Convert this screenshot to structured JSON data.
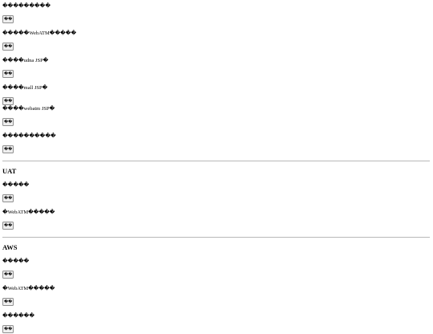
{
  "sections": [
    {
      "heading": "",
      "items": [
        {
          "label": "���������",
          "button": "��"
        },
        {
          "label": "�����WebATM�����",
          "button": "��"
        },
        {
          "label": "����udna JSP�",
          "button": "��"
        },
        {
          "label": "����mall JSP�",
          "button": "��"
        },
        {
          "label": "����webatm JSP�",
          "button": "��"
        },
        {
          "label": "����������",
          "button": "��"
        }
      ]
    },
    {
      "heading": "UAT",
      "items": [
        {
          "label": "�����",
          "button": "��"
        },
        {
          "label": "�WebATM�����",
          "button": "��"
        }
      ]
    },
    {
      "heading": "AWS",
      "items": [
        {
          "label": "�����",
          "button": "��"
        },
        {
          "label": "�WebATM�����",
          "button": "��"
        },
        {
          "label": "������",
          "button": "��"
        }
      ]
    }
  ]
}
